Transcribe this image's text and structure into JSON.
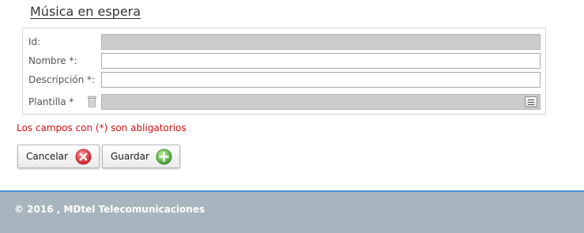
{
  "page": {
    "title": "Música en espera"
  },
  "form": {
    "fields": [
      {
        "label": "Id:",
        "value": "",
        "disabled": true
      },
      {
        "label": "Nombre *:",
        "value": "",
        "disabled": false
      },
      {
        "label": "Descripción *:",
        "value": "",
        "disabled": false
      },
      {
        "label": "Plantilla *",
        "value": "",
        "disabled": true
      }
    ],
    "required_note": "Los campos con (*) son abligatorios"
  },
  "actions": {
    "cancel_label": "Cancelar",
    "save_label": "Guardar",
    "cancel_icon": "red-x-circle-icon",
    "save_icon": "green-plus-circle-icon"
  },
  "footer": {
    "text": "© 2016 , MDtel Telecomunicaciones"
  },
  "colors": {
    "required_note": "#cc1111",
    "footer_bg": "#a7b5be",
    "footer_border": "#4a90d9",
    "disabled_field": "#cccccc"
  }
}
